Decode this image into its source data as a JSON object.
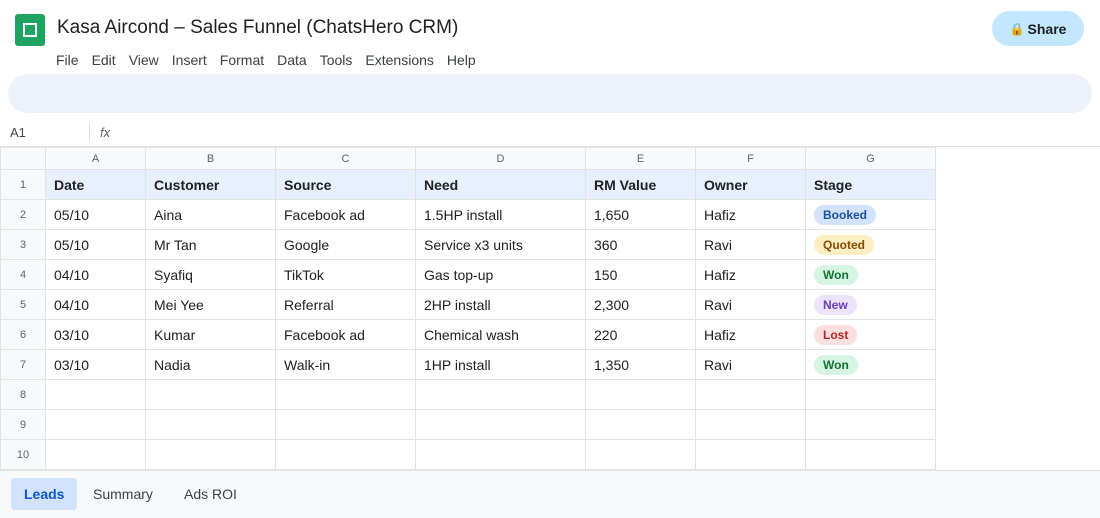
{
  "app": {
    "title": "Kasa Aircond – Sales Funnel (ChatsHero CRM)",
    "logo_icon": "sheets-logo-icon",
    "share_label": "Share",
    "share_icon": "lock-icon",
    "share_glyph": "🔒"
  },
  "menu": [
    "File",
    "Edit",
    "View",
    "Insert",
    "Format",
    "Data",
    "Tools",
    "Extensions",
    "Help"
  ],
  "formula_bar": {
    "cell_ref": "A1",
    "fx_label": "fx",
    "value": ""
  },
  "grid": {
    "columns": [
      "A",
      "B",
      "C",
      "D",
      "E",
      "F",
      "G"
    ],
    "row_numbers": [
      "1",
      "2",
      "3",
      "4",
      "5",
      "6",
      "7",
      "8",
      "9",
      "10"
    ],
    "header": [
      "Date",
      "Customer",
      "Source",
      "Need",
      "RM Value",
      "Owner",
      "Stage"
    ],
    "rows": [
      [
        "05/10",
        "Aina",
        "Facebook ad",
        "1.5HP install",
        "1,650",
        "Hafiz",
        "Booked"
      ],
      [
        "05/10",
        "Mr Tan",
        "Google",
        "Service x3 units",
        "360",
        "Ravi",
        "Quoted"
      ],
      [
        "04/10",
        "Syafiq",
        "TikTok",
        "Gas top-up",
        "150",
        "Hafiz",
        "Won"
      ],
      [
        "04/10",
        "Mei Yee",
        "Referral",
        "2HP install",
        "2,300",
        "Ravi",
        "New"
      ],
      [
        "03/10",
        "Kumar",
        "Facebook ad",
        "Chemical wash",
        "220",
        "Hafiz",
        "Lost"
      ],
      [
        "03/10",
        "Nadia",
        "Walk-in",
        "1HP install",
        "1,350",
        "Ravi",
        "Won"
      ]
    ],
    "empty_rows": 3
  },
  "stage_colors": {
    "Booked": {
      "bg": "#d3e3fd",
      "fg": "#1a4fa3"
    },
    "Quoted": {
      "bg": "#feefc3",
      "fg": "#8a4a00"
    },
    "Won": {
      "bg": "#d6f5e3",
      "fg": "#137333"
    },
    "New": {
      "bg": "#ebe4fb",
      "fg": "#6a3cc1"
    },
    "Lost": {
      "bg": "#fce0e0",
      "fg": "#b3261e"
    }
  },
  "sheet_tabs": [
    {
      "label": "Leads",
      "active": true
    },
    {
      "label": "Summary",
      "active": false
    },
    {
      "label": "Ads ROI",
      "active": false
    }
  ]
}
